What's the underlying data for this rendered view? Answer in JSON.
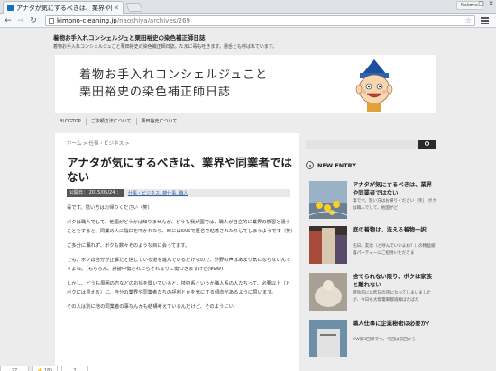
{
  "browser": {
    "tab_title": "アナタが気にするべきは、業界や同業者",
    "profile_label": "Nakano",
    "url_domain": "kimono-cleaning.jp",
    "url_path": "/naoshiya/archives/269"
  },
  "site": {
    "title": "着物お手入れコンシェルジュと栗田裕史の染色補正師日誌",
    "description": "着物お手入れコンシェルジュこと栗田裕史の染色補正師日誌。たまに毒も吐きます。悪舌とも呼ばれています。",
    "banner_line1": "着物お手入れコンシェルジュこと",
    "banner_line2": "栗田裕史の染色補正師日誌"
  },
  "nav": [
    "BLOGTOP",
    "ご依頼方法について",
    "栗田裕史について"
  ],
  "article": {
    "breadcrumb": "ホーム > 仕事・ビジネス >",
    "title": "アナタが気にするべきは、業界や同業者ではない",
    "date": "公開日： 2015/05/24 ：",
    "categories": "仕事・ビジネス, 雑仕事, 職人",
    "paragraphs": [
      "毒です。怒い方はお帰りください（笑）",
      "ボクは職人でして、他国がどうかは知りませんが、どうも我が国では、職人が自立的に業界の慣習と違うことをすると、同業の人に陰口を叩かれたり、時にはSNSで匿名で粘着されたりしてしまうようです（笑）",
      "ご多分に漏れず、ボクも数々そのような目に会ってます。",
      "でも、ボクは自分が正解だと信じている道を進んでいるだけなので、外野の声はあまり気にならないんですよね。（もちろん、誹謗中傷されたらそれなりに傷つきますけど(Φω̈Φ)",
      "しかし、どうも周囲の方などのお話を聞いていると、技術系というか職人系の人たちって、必要以上（とボクには見える）に、自分の業界や同業者たちの評判とかを気にする傾向があるように思います。",
      "その人は別に他の同業者の事なんかも結構考えているんだけど、そのようにい"
    ]
  },
  "sidebar": {
    "new_entry_label": "NEW ENTRY",
    "entries": [
      {
        "title": "アナタが気にするべきは、業界や同業者ではない",
        "excerpt": "毒です。怒い方はお帰りください（笑） ボクは職人でして、他国がど"
      },
      {
        "title": "庭の着物は、洗える着物一択",
        "excerpt": "先日、友達（と呼んでいいよね？）の精猛披露パーティーにご招待いただきま"
      },
      {
        "title": "捨てられない限り、ボクは家族と離れない",
        "excerpt": "時効前には昨日の話になってしまいましたが、今日も大阪電車都道線ばたばた"
      },
      {
        "title": "職人仕事に企業秘密は必要か？",
        "excerpt": "CW第3回目です。今回は前回から"
      }
    ]
  },
  "social": {
    "count1": "27",
    "count2": "185",
    "count3": "2"
  },
  "colors": {
    "accent_blue": "#3264b0",
    "dark_button": "#2a2a2a",
    "page_bg": "#ececec"
  }
}
